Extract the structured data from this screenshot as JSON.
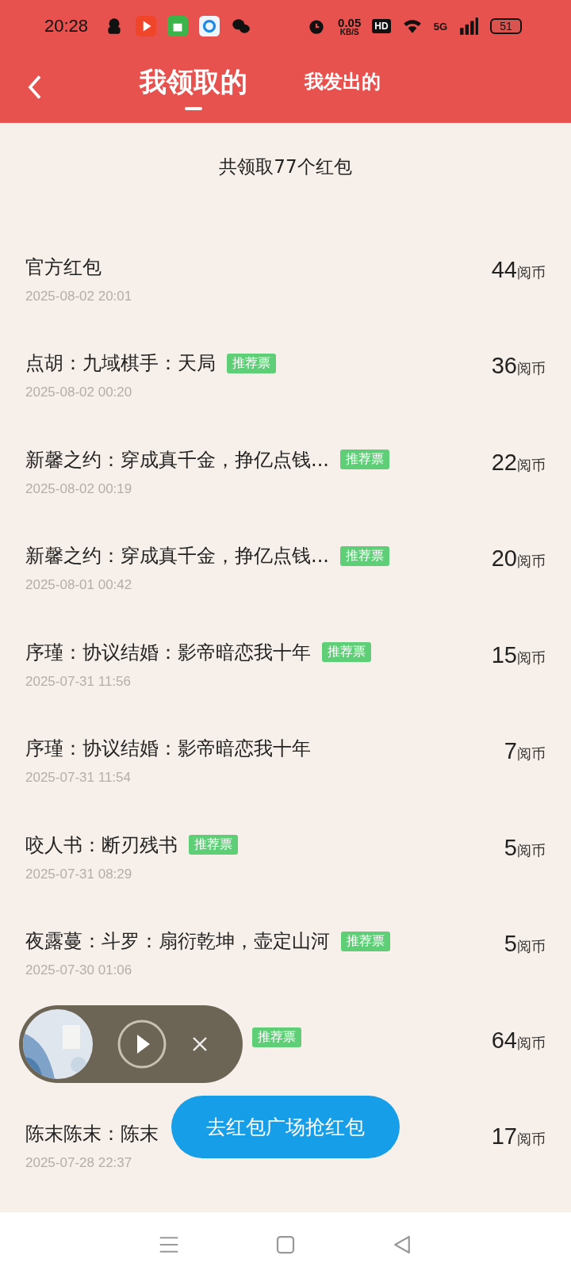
{
  "status_bar": {
    "time": "20:28",
    "speed": "0.05",
    "speed_unit": "KB/S",
    "hd": "HD",
    "network": "5G",
    "battery": "51"
  },
  "header": {
    "tabs": [
      {
        "label": "我领取的",
        "selected": true
      },
      {
        "label": "我发出的",
        "selected": false
      }
    ]
  },
  "summary": "共领取77个红包",
  "records": [
    {
      "title": "官方红包",
      "amount": "44",
      "unit": "阅币",
      "date": "2025-08-02 20:01"
    },
    {
      "title": "点胡：九域棋手：天局",
      "tag": "推荐票",
      "amount": "36",
      "unit": "阅币",
      "date": "2025-08-02 00:20"
    },
    {
      "title": "新馨之约：穿成真千金，挣亿点钱...",
      "tag": "推荐票",
      "amount": "22",
      "unit": "阅币",
      "date": "2025-08-02 00:19"
    },
    {
      "title": "新馨之约：穿成真千金，挣亿点钱...",
      "tag": "推荐票",
      "amount": "20",
      "unit": "阅币",
      "date": "2025-08-01 00:42"
    },
    {
      "title": "序瑾：协议结婚：影帝暗恋我十年",
      "tag": "推荐票",
      "amount": "15",
      "unit": "阅币",
      "date": "2025-07-31 11:56"
    },
    {
      "title": "序瑾：协议结婚：影帝暗恋我十年",
      "amount": "7",
      "unit": "阅币",
      "date": "2025-07-31 11:54"
    },
    {
      "title": "咬人书：断刃残书",
      "tag": "推荐票",
      "amount": "5",
      "unit": "阅币",
      "date": "2025-07-31 08:29"
    },
    {
      "title": "夜露蔓：斗罗：扇衍乾坤，壶定山河",
      "tag": "推荐票",
      "amount": "5",
      "unit": "阅币",
      "date": "2025-07-30 01:06"
    },
    {
      "tag": "推荐票",
      "amount": "64",
      "unit": "阅币"
    },
    {
      "title": "陈末陈末：陈末",
      "amount": "17",
      "unit": "阅币",
      "date": "2025-07-28 22:37"
    }
  ],
  "float_button": "去红包广场抢红包"
}
